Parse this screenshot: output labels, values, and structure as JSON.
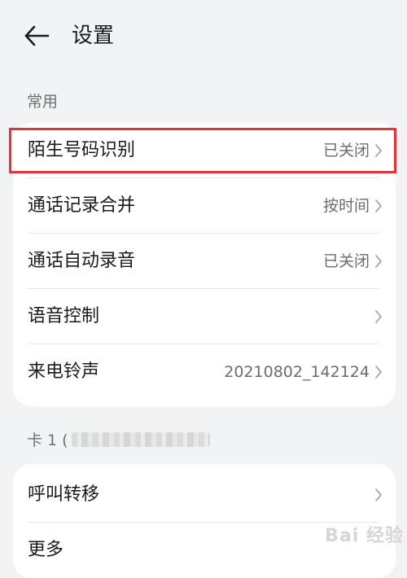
{
  "header": {
    "title": "设置"
  },
  "sections": {
    "common": {
      "title": "常用",
      "rows": [
        {
          "label": "陌生号码识别",
          "value": "已关闭"
        },
        {
          "label": "通话记录合并",
          "value": "按时间"
        },
        {
          "label": "通话自动录音",
          "value": "已关闭"
        },
        {
          "label": "语音控制",
          "value": ""
        },
        {
          "label": "来电铃声",
          "value": "20210802_142124"
        }
      ]
    },
    "card1": {
      "title": "卡 1 (",
      "rows": [
        {
          "label": "呼叫转移",
          "value": ""
        },
        {
          "label": "更多",
          "value": ""
        }
      ]
    }
  },
  "watermark": "Bai 经验",
  "colors": {
    "highlight": "#e8323a",
    "background": "#f1f3f5"
  },
  "icons": {
    "back": "arrow-left-icon",
    "row_nav": "chevron-right-icon"
  }
}
